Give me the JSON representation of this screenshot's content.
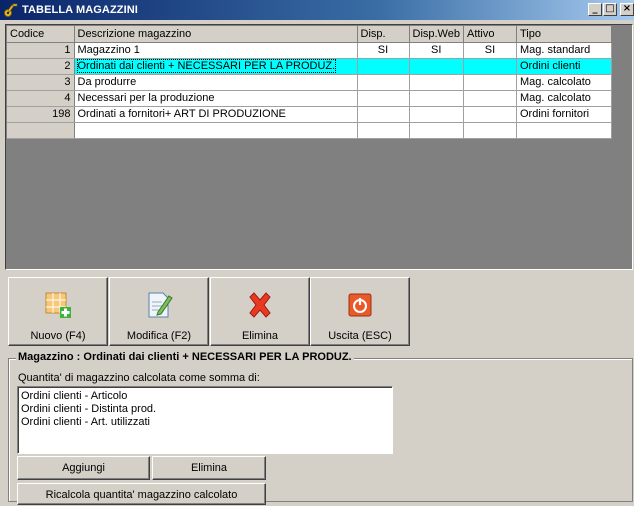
{
  "window": {
    "title": "TABELLA MAGAZZINI"
  },
  "grid": {
    "columns": [
      "Codice",
      "Descrizione magazzino",
      "Disp.",
      "Disp.Web",
      "Attivo",
      "Tipo"
    ],
    "rows": [
      {
        "code": "1",
        "desc": "Magazzino 1",
        "disp": "SI",
        "web": "SI",
        "attivo": "SI",
        "tipo": "Mag. standard"
      },
      {
        "code": "2",
        "desc": "Ordinati dai clienti + NECESSARI  PER LA PRODUZ.",
        "disp": "",
        "web": "",
        "attivo": "",
        "tipo": "Ordini clienti"
      },
      {
        "code": "3",
        "desc": "Da produrre",
        "disp": "",
        "web": "",
        "attivo": "",
        "tipo": "Mag. calcolato"
      },
      {
        "code": "4",
        "desc": "Necessari per la produzione",
        "disp": "",
        "web": "",
        "attivo": "",
        "tipo": "Mag. calcolato"
      },
      {
        "code": "198",
        "desc": "Ordinati a fornitori+ ART DI PRODUZIONE",
        "disp": "",
        "web": "",
        "attivo": "",
        "tipo": "Ordini fornitori"
      },
      {
        "code": "",
        "desc": "",
        "disp": "",
        "web": "",
        "attivo": "",
        "tipo": ""
      }
    ],
    "selected_row_index": 1
  },
  "toolbar": {
    "new_label": "Nuovo (F4)",
    "edit_label": "Modifica (F2)",
    "delete_label": "Elimina",
    "exit_label": "Uscita (ESC)"
  },
  "detail": {
    "group_title": "Magazzino : Ordinati dai clienti + NECESSARI  PER LA PRODUZ.",
    "sum_label": "Quantita' di magazzino calcolata come somma di:",
    "items": [
      "Ordini clienti - Articolo",
      "Ordini clienti - Distinta prod.",
      "Ordini clienti - Art. utilizzati"
    ],
    "add_label": "Aggiungi",
    "remove_label": "Elimina",
    "recalc_label": "Ricalcola quantita' magazzino calcolato"
  },
  "colors": {
    "selection": "#00ffff",
    "titlebar": "#0a246a",
    "face": "#d4d0c8"
  }
}
